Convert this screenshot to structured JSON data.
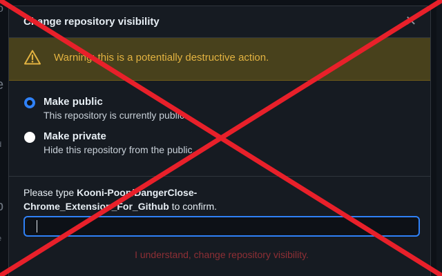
{
  "dialog": {
    "title": "Change repository visibility",
    "close_icon": "close-icon"
  },
  "warning": {
    "icon": "warning-triangle-icon",
    "text": "Warning: this is a potentially destructive action."
  },
  "options": [
    {
      "label": "Make public",
      "description": "This repository is currently public.",
      "selected": true
    },
    {
      "label": "Make private",
      "description": "Hide this repository from the public.",
      "selected": false
    }
  ],
  "confirm": {
    "prefix": "Please type ",
    "repo": "Kooni-Poop/DangerClose-Chrome_Extension_For_Github",
    "suffix": " to confirm.",
    "input_value": "",
    "button_label": "I understand, change repository visibility."
  },
  "overlay": {
    "icon": "red-x-cross-icon",
    "color": "#e8202a"
  },
  "colors": {
    "accent": "#2f81f7",
    "warning_bg": "#48411c",
    "warning_text": "#e3b341",
    "danger_disabled": "#8e2f35"
  }
}
